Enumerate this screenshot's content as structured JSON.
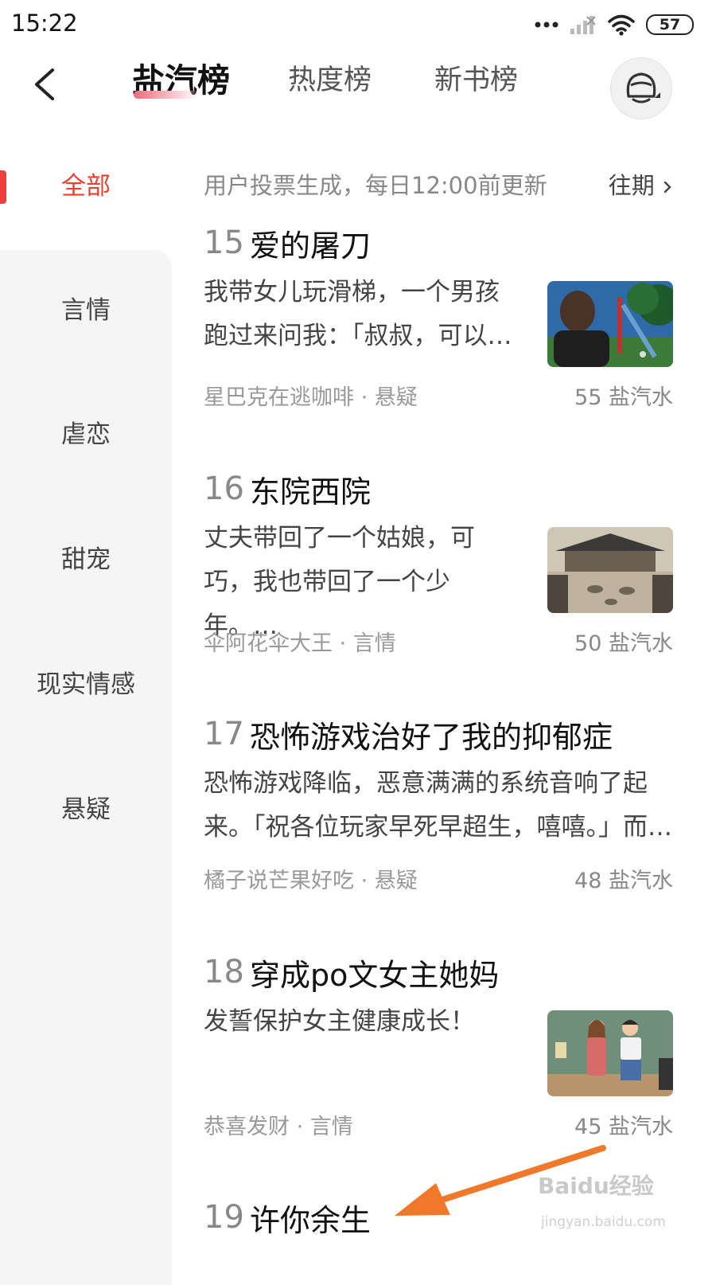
{
  "status_bar": {
    "time": "15:22",
    "battery": "57",
    "icons": [
      "more-dots-icon",
      "signal-icon",
      "wifi-icon",
      "battery-icon"
    ]
  },
  "header": {
    "tabs": [
      {
        "label": "盐汽榜",
        "active": true
      },
      {
        "label": "热度榜",
        "active": false
      },
      {
        "label": "新书榜",
        "active": false
      }
    ],
    "icons": [
      "back-arrow-icon",
      "avatar-icon"
    ]
  },
  "sidebar": {
    "items": [
      {
        "label": "全部",
        "active": true
      },
      {
        "label": "言情",
        "active": false
      },
      {
        "label": "虐恋",
        "active": false
      },
      {
        "label": "甜宠",
        "active": false
      },
      {
        "label": "现实情感",
        "active": false
      },
      {
        "label": "悬疑",
        "active": false
      }
    ]
  },
  "list": {
    "subtitle": "用户投票生成，每日12:00前更新",
    "past_label": "往期",
    "books": [
      {
        "rank": "15",
        "title": "爱的屠刀",
        "desc": "我带女儿玩滑梯，一个男孩跑过来问我：「叔叔，可以…",
        "author_genre": "星巴克在逃咖啡 · 悬疑",
        "score": "55 盐汽水",
        "has_cover": true
      },
      {
        "rank": "16",
        "title": "东院西院",
        "desc": "丈夫带回了一个姑娘，可巧，我也带回了一个少年。…",
        "author_genre": "伞阿花伞大王 · 言情",
        "score": "50 盐汽水",
        "has_cover": true
      },
      {
        "rank": "17",
        "title": "恐怖游戏治好了我的抑郁症",
        "desc": "恐怖游戏降临，恶意满满的系统音响了起来。「祝各位玩家早死早超生，嘻嘻。」而…",
        "author_genre": "橘子说芒果好吃 · 悬疑",
        "score": "48 盐汽水",
        "has_cover": false
      },
      {
        "rank": "18",
        "title": "穿成po文女主她妈",
        "desc": "发誓保护女主健康成长！",
        "author_genre": "恭喜发财 · 言情",
        "score": "45 盐汽水",
        "has_cover": true
      },
      {
        "rank": "19",
        "title": "许你余生"
      }
    ]
  },
  "watermark": {
    "text": "Baidu经验",
    "sub": "jingyan.baidu.com"
  },
  "colors": {
    "accent_red": "#e8412f",
    "arrow_orange": "#f0782a",
    "sidebar_bg": "#f5f5f5"
  }
}
